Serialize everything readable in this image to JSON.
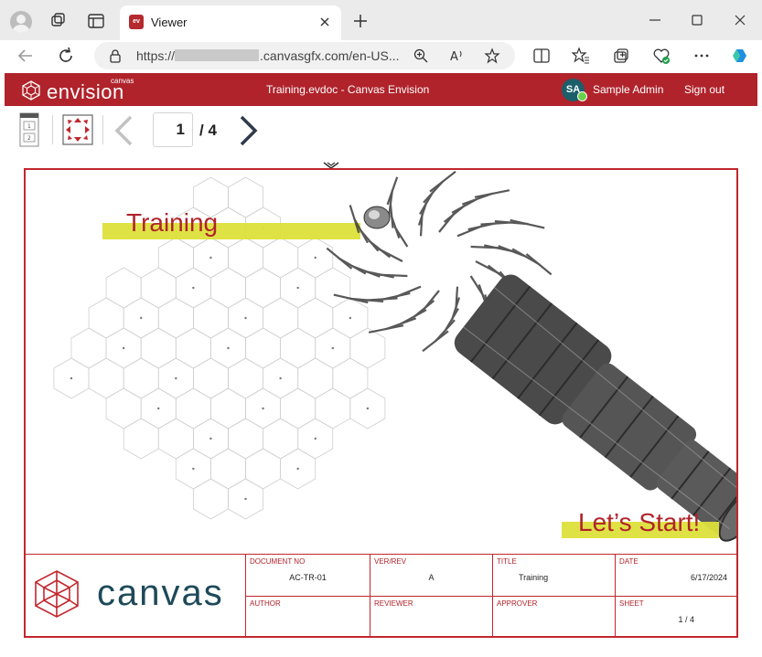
{
  "browser": {
    "tab_title": "Viewer",
    "tab_favicon": "ev",
    "url_prefix": "https://",
    "url_suffix": ".canvasgfx.com/en-US...",
    "icons": [
      "profile-icon",
      "workspaces-icon",
      "tab-actions-icon",
      "close-icon",
      "new-tab-icon",
      "minimize-icon",
      "maximize-icon",
      "window-close-icon",
      "back-icon",
      "refresh-icon",
      "lock-icon",
      "zoom-icon",
      "read-aloud-icon",
      "favorite-icon",
      "split-screen-icon",
      "favorites-icon",
      "collections-icon",
      "browser-essentials-icon",
      "more-icon",
      "copilot-icon"
    ]
  },
  "app": {
    "brand_name": "envision",
    "brand_sup": "canvas",
    "doc_title": "Training.evdoc - Canvas Envision",
    "user_initials": "SA",
    "user_name": "Sample Admin",
    "sign_out": "Sign out"
  },
  "toolbar": {
    "current_page": "1",
    "total_pages": "/ 4"
  },
  "sheet": {
    "heading": "Training",
    "cta": "Let’s Start!",
    "accent": "#c1272d",
    "highlight": "#dde03a"
  },
  "title_block": {
    "logo_word": "canvas",
    "fields": [
      {
        "label": "DOCUMENT NO",
        "value": "AC-TR-01"
      },
      {
        "label": "VER/REV",
        "value": "A"
      },
      {
        "label": "TITLE",
        "value": "Training"
      },
      {
        "label": "DATE",
        "value": "6/17/2024"
      },
      {
        "label": "AUTHOR",
        "value": ""
      },
      {
        "label": "REVIEWER",
        "value": ""
      },
      {
        "label": "APPROVER",
        "value": ""
      },
      {
        "label": "SHEET",
        "value": "1 / 4"
      }
    ]
  }
}
